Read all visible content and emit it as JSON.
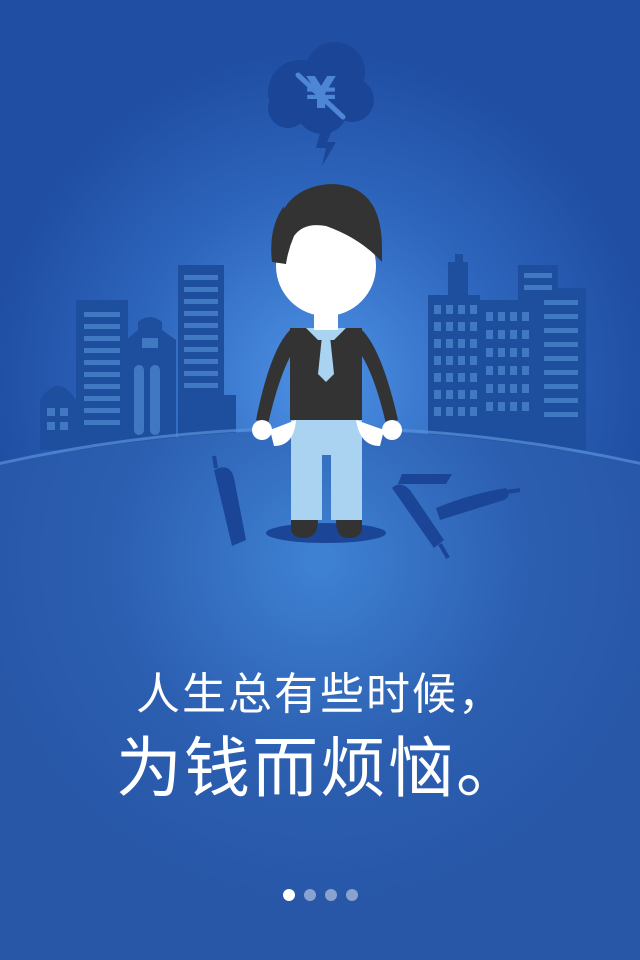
{
  "onboarding": {
    "line1": "人生总有些时候，",
    "line2": "为钱而烦恼。",
    "cloud_symbol": "¥",
    "page_indicator": {
      "total": 4,
      "active_index": 0
    }
  },
  "colors": {
    "background_top": "#1f4ea3",
    "background_glow": "#4a8ee0",
    "ground": "#2b5eb0",
    "buildings": "#1e4f9e",
    "building_detail": "#5f9be0",
    "cloud": "#1b4597",
    "hair": "#333333",
    "shirt": "#333333",
    "pants": "#a9d3f0",
    "tie": "#a9d3f0"
  }
}
